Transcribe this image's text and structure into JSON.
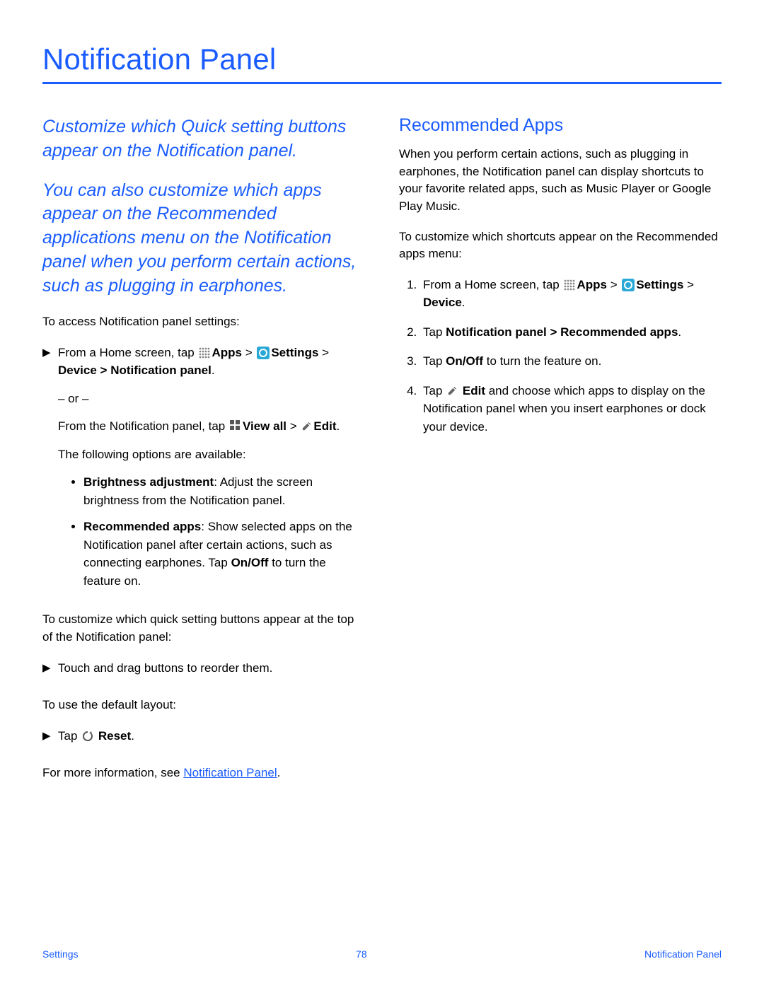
{
  "title": "Notification Panel",
  "left": {
    "intro1": "Customize which Quick setting buttons appear on the Notification panel.",
    "intro2": "You can also customize which apps appear on the Recommended applications menu on the Notification panel when you perform certain actions, such as plugging in earphones.",
    "access_intro": "To access Notification panel settings:",
    "step1_pre": "From a Home screen, tap ",
    "apps_label": "Apps",
    "gt1": " > ",
    "settings_label": "Settings",
    "step1_post": " > ",
    "device_np": "Device > Notification panel",
    "dot": ".",
    "or": "– or –",
    "from_np": "From the Notification panel, tap ",
    "viewall_label": "View all",
    "gt2": " > ",
    "edit_label": "Edit",
    "options_intro": "The following options are available:",
    "bullet1_b": "Brightness adjustment",
    "bullet1_rest": ": Adjust the screen brightness from the Notification panel.",
    "bullet2_b": "Recommended apps",
    "bullet2_rest": ": Show selected apps on the Notification panel after certain actions, such as connecting earphones. Tap ",
    "onoff": "On/Off",
    "bullet2_tail": " to turn the feature on.",
    "customize_qs": "To customize which quick setting buttons appear at the top of the Notification panel:",
    "drag": "Touch and drag buttons to reorder them.",
    "default_intro": "To use the default layout:",
    "tap": "Tap ",
    "reset_label": "Reset",
    "more_info_pre": "For more information, see ",
    "np_link": "Notification Panel"
  },
  "right": {
    "heading": "Recommended Apps",
    "p1": "When you perform certain actions, such as plugging in earphones, the Notification panel can display shortcuts to your favorite related apps, such as Music Player or Google Play Music.",
    "p2": "To customize which shortcuts appear on the Recommended apps menu:",
    "s1_pre": "From a Home screen, tap ",
    "s1_apps": "Apps",
    "s1_gt": " > ",
    "s1_settings": "Settings",
    "s1_post": " > ",
    "s1_device": "Device",
    "s2_pre": "Tap ",
    "s2_b": "Notification panel > Recommended apps",
    "s3_pre": "Tap ",
    "s3_b": "On/Off",
    "s3_post": " to turn the feature on.",
    "s4_pre": "Tap ",
    "s4_edit": "Edit",
    "s4_post": " and choose which apps to display on the Notification panel when you insert earphones or dock your device."
  },
  "footer": {
    "left": "Settings",
    "center": "78",
    "right": "Notification Panel"
  }
}
